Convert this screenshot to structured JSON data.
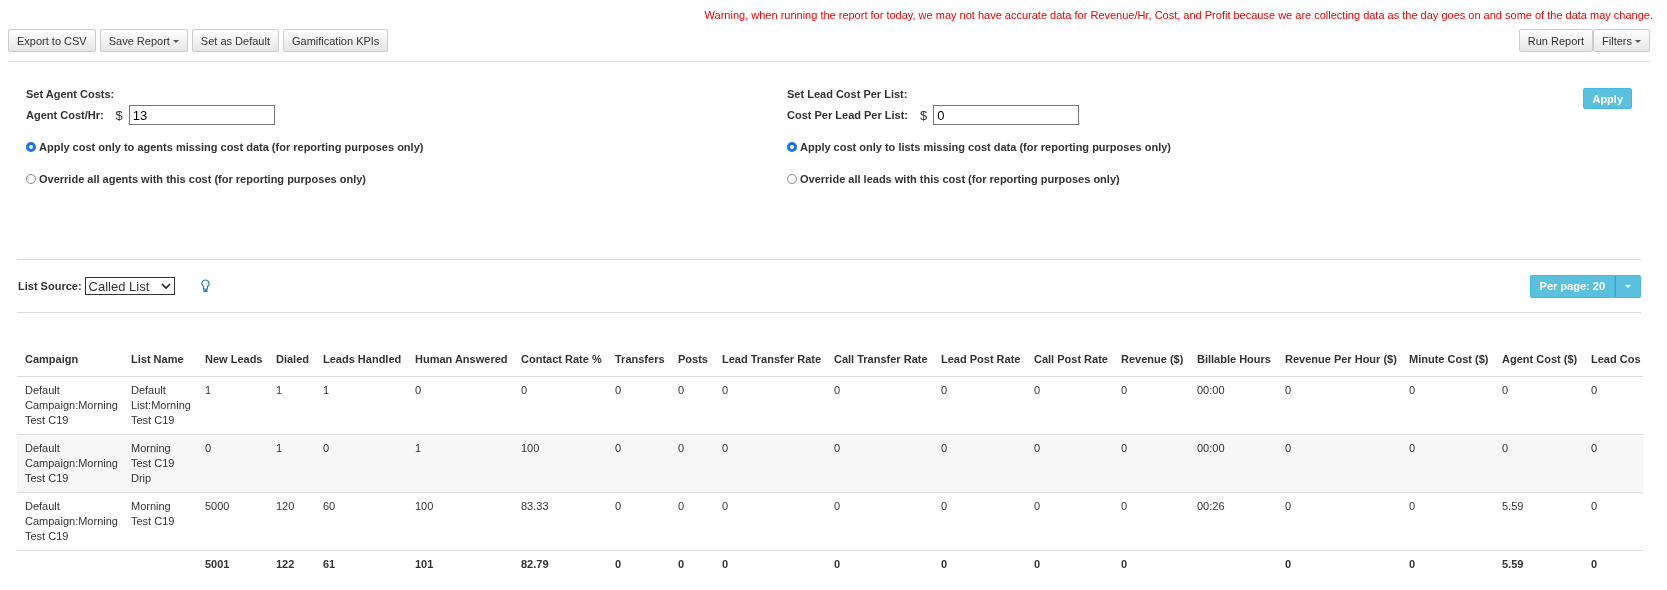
{
  "warning": "Warning, when running the report for today, we may not have accurate data for Revenue/Hr, Cost, and Profit because we are collecting data as the day goes on and some of the data may change.",
  "toolbar_left": [
    {
      "label": "Export to CSV",
      "dropdown": false
    },
    {
      "label": "Save Report",
      "dropdown": true
    },
    {
      "label": "Set as Default",
      "dropdown": false
    },
    {
      "label": "Gamification KPIs",
      "dropdown": false
    }
  ],
  "toolbar_right": [
    {
      "label": "Run Report",
      "dropdown": false
    },
    {
      "label": "Filters",
      "dropdown": true
    }
  ],
  "agent_costs": {
    "title": "Set Agent Costs:",
    "field_label": "Agent Cost/Hr:",
    "currency": "$",
    "value": "13",
    "options": [
      {
        "label": "Apply cost only to agents missing cost data (for reporting purposes only)",
        "selected": true
      },
      {
        "label": "Override all agents with this cost (for reporting purposes only)",
        "selected": false
      }
    ]
  },
  "lead_costs": {
    "title": "Set Lead Cost Per List:",
    "field_label": "Cost Per Lead Per List:",
    "currency": "$",
    "value": "0",
    "options": [
      {
        "label": "Apply cost only to lists missing cost data (for reporting purposes only)",
        "selected": true
      },
      {
        "label": "Override all leads with this cost (for reporting purposes only)",
        "selected": false
      }
    ]
  },
  "apply_button": "Apply",
  "list_source": {
    "label": "List Source:",
    "value": "Called List"
  },
  "per_page": "Per page: 20",
  "table": {
    "columns": [
      "Campaign",
      "List Name",
      "New Leads",
      "Dialed",
      "Leads Handled",
      "Human Answered",
      "Contact Rate %",
      "Transfers",
      "Posts",
      "Lead Transfer Rate",
      "Call Transfer Rate",
      "Lead Post Rate",
      "Call Post Rate",
      "Revenue ($)",
      "Billable Hours",
      "Revenue Per Hour ($)",
      "Minute Cost ($)",
      "Agent Cost ($)",
      "Lead Cos"
    ],
    "rows": [
      {
        "kind": "data",
        "cells": [
          "Default Campaign:Morning Test C19",
          "Default List:Morning Test C19",
          "1",
          "1",
          "1",
          "0",
          "0",
          "0",
          "0",
          "0",
          "0",
          "0",
          "0",
          "0",
          "00:00",
          "0",
          "0",
          "0",
          "0"
        ]
      },
      {
        "kind": "data",
        "cells": [
          "Default Campaign:Morning Test C19",
          "Morning Test C19 Drip",
          "0",
          "1",
          "0",
          "1",
          "100",
          "0",
          "0",
          "0",
          "0",
          "0",
          "0",
          "0",
          "00:00",
          "0",
          "0",
          "0",
          "0"
        ]
      },
      {
        "kind": "data",
        "cells": [
          "Default Campaign:Morning Test C19",
          "Morning Test C19",
          "5000",
          "120",
          "60",
          "100",
          "83.33",
          "0",
          "0",
          "0",
          "0",
          "0",
          "0",
          "0",
          "00:26",
          "0",
          "0",
          "5.59",
          "0"
        ]
      },
      {
        "kind": "total",
        "cells": [
          "",
          "",
          "5001",
          "122",
          "61",
          "101",
          "82.79",
          "0",
          "0",
          "0",
          "0",
          "0",
          "0",
          "0",
          "",
          "0",
          "0",
          "5.59",
          "0"
        ]
      }
    ]
  }
}
